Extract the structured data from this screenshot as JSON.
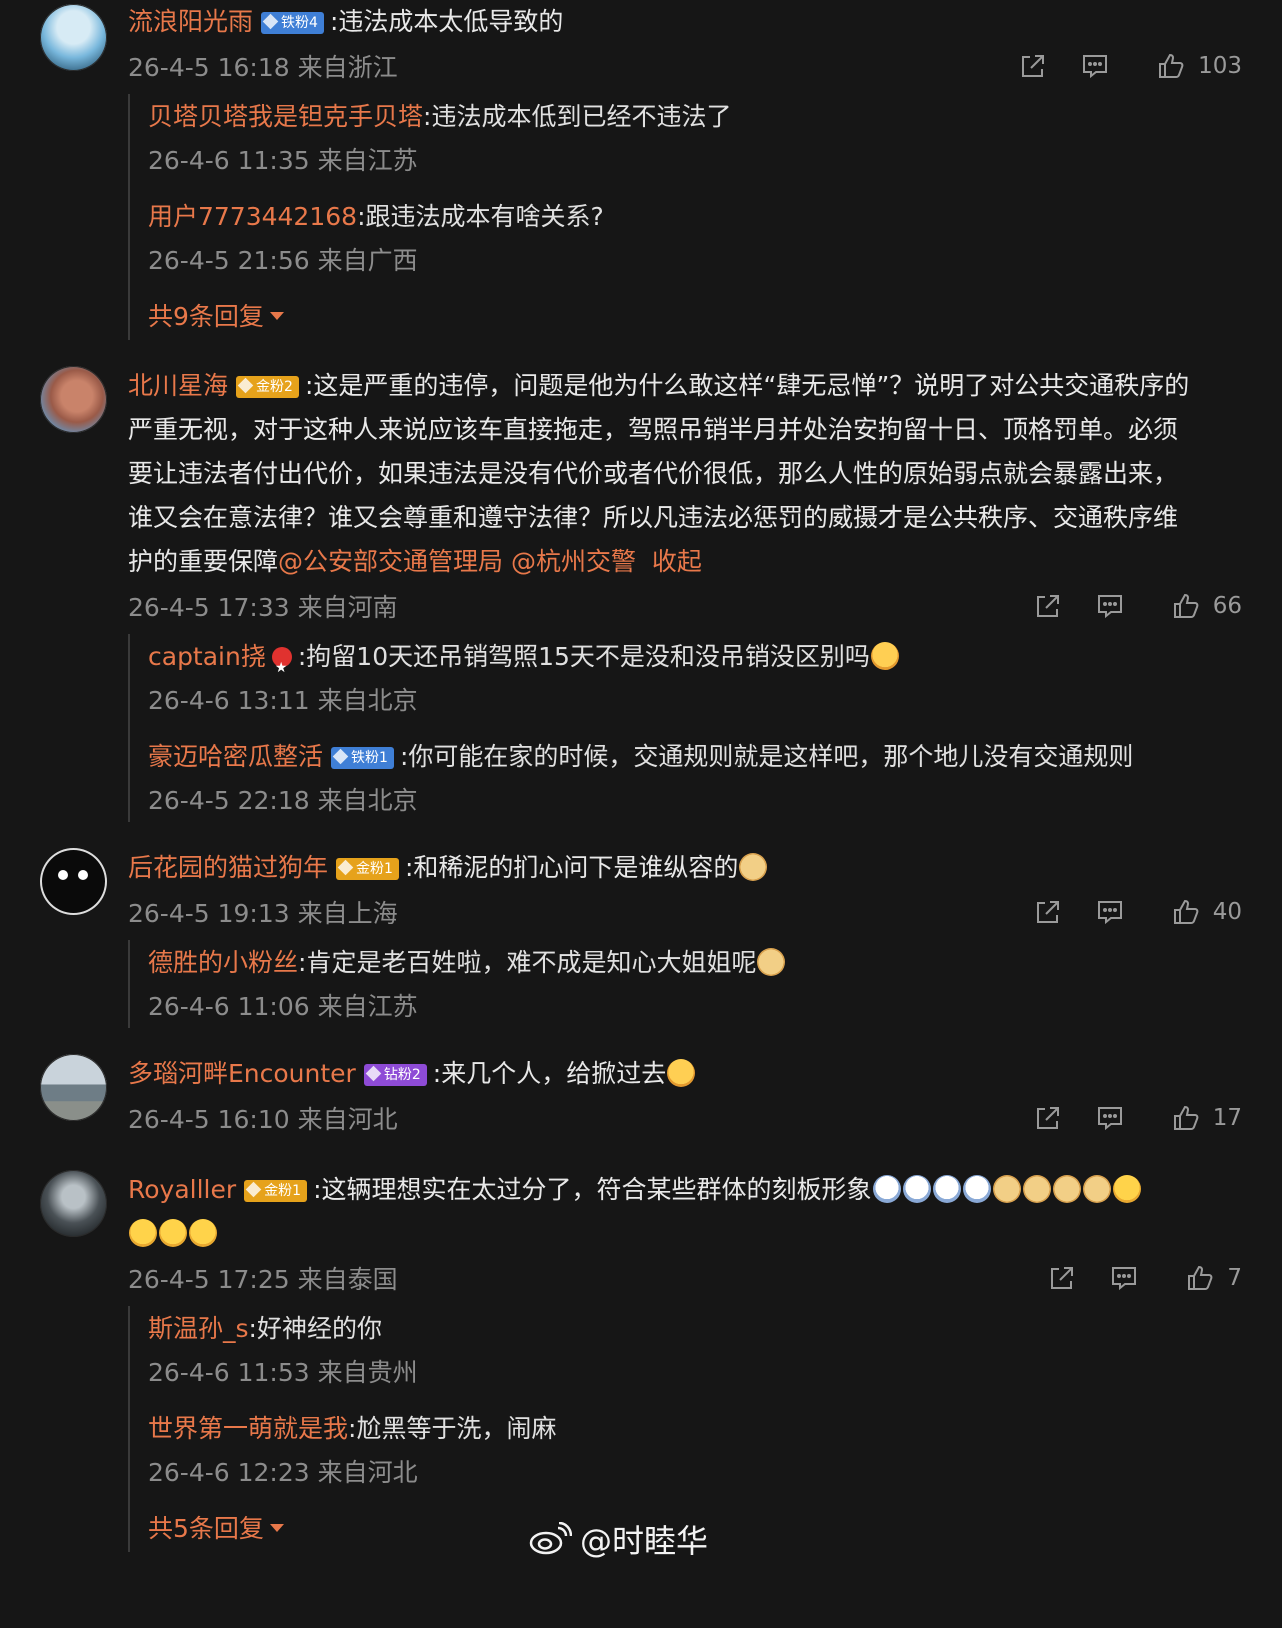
{
  "comments": [
    {
      "user": "流浪阳光雨",
      "badge": "铁粉4",
      "text": ":违法成本太低导致的",
      "time": "26-4-5 16:18 来自浙江",
      "likes": "103",
      "replies": [
        {
          "user": "贝塔贝塔我是钽克手贝塔",
          "text": ":违法成本低到已经不违法了",
          "time": "26-4-6 11:35 来自江苏"
        },
        {
          "user": "用户7773442168",
          "text": ":跟违法成本有啥关系?",
          "time": "26-4-5 21:56 来自广西"
        }
      ],
      "more": "共9条回复"
    },
    {
      "user": "北川星海",
      "badge": "金粉2",
      "text_l1": ":这是严重的违停，问题是他为什么敢这样“肆无忌惮”？说明了对公共交通秩序的",
      "text_l2": "严重无视，对于这种人来说应该车直接拖走，驾照吊销半月并处治安拘留十日、顶格罚单。必须",
      "text_l3": "要让违法者付出代价，如果违法是没有代价或者代价很低，那么人性的原始弱点就会暴露出来，",
      "text_l4": "谁又会在意法律？谁又会尊重和遵守法律？所以凡违法必惩罚的威摄才是公共秩序、交通秩序维",
      "text_l5": "护的重要保障",
      "mention1": "@公安部交通管理局",
      "mention2": "@杭州交警",
      "collapse": "收起",
      "time": "26-4-5 17:33 来自河南",
      "likes": "66",
      "replies": [
        {
          "user": "captain挠",
          "text": ":拘留10天还吊销驾照15天不是没和没吊销没区别吗",
          "time": "26-4-6 13:11 来自北京"
        },
        {
          "user": "豪迈哈密瓜整活",
          "badge": "铁粉1",
          "text": ":你可能在家的时候，交通规则就是这样吧，那个地儿没有交通规则",
          "time": "26-4-5 22:18 来自北京"
        }
      ]
    },
    {
      "user": "后花园的猫过狗年",
      "badge": "金粉1",
      "text": ":和稀泥的扪心问下是谁纵容的",
      "time": "26-4-5 19:13 来自上海",
      "likes": "40",
      "replies": [
        {
          "user": "德胜的小粉丝",
          "text": ":肯定是老百姓啦，难不成是知心大姐姐呢",
          "time": "26-4-6 11:06 来自江苏"
        }
      ]
    },
    {
      "user": "多瑙河畔Encounter",
      "badge": "钻粉2",
      "text": ":来几个人，给掀过去",
      "time": "26-4-5 16:10 来自河北",
      "likes": "17"
    },
    {
      "user": "Royalller",
      "badge": "金粉1",
      "text": ":这辆理想实在太过分了，符合某些群体的刻板形象",
      "time": "26-4-5 17:25 来自泰国",
      "likes": "7",
      "replies": [
        {
          "user": "斯温孙_s",
          "text": ":好神经的你",
          "time": "26-4-6 11:53 来自贵州"
        },
        {
          "user": "世界第一萌就是我",
          "text": ":尬黑等于洗，闹麻",
          "time": "26-4-6 12:23 来自河北"
        }
      ],
      "more": "共5条回复"
    }
  ],
  "icons": {
    "share": "share-icon",
    "comment": "comment-icon",
    "like": "thumbs-up-icon"
  },
  "watermark": "@时睦华",
  "colors": {
    "background": "#161616",
    "username": "#e8784a",
    "meta": "#8c8c8c",
    "text": "#e8e8e8"
  }
}
